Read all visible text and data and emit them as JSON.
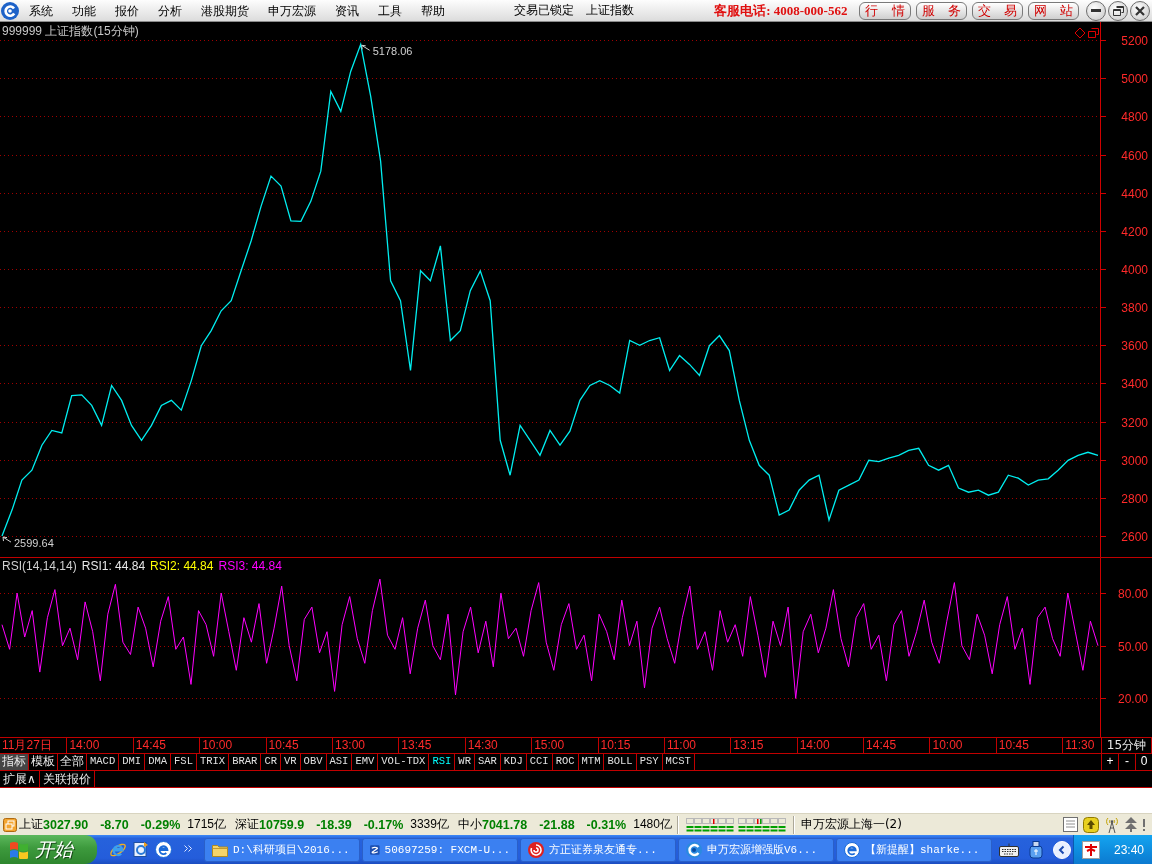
{
  "menu_bar": {
    "items": [
      "系统",
      "功能",
      "报价",
      "分析",
      "港股期货",
      "申万宏源",
      "资讯",
      "工具",
      "帮助"
    ],
    "lock_status": "交易已锁定",
    "current_index": "上证指数",
    "hotline": "客服电话: 4008-000-562",
    "quick_buttons": [
      "行 情",
      "服 务",
      "交 易",
      "网 站"
    ]
  },
  "price_chart": {
    "chart_data": {
      "type": "line",
      "title": "999999 上证指数(15分钟)",
      "grid": true,
      "ylim": [
        2490,
        5295
      ],
      "yticks": [
        2600,
        2800,
        3000,
        3200,
        3400,
        3600,
        3800,
        4000,
        4200,
        4400,
        4600,
        4800,
        5000,
        5200
      ],
      "values": [
        2599.64,
        2736,
        2893,
        2945,
        3076,
        3154,
        3140,
        3337,
        3340,
        3285,
        3180,
        3389,
        3311,
        3180,
        3102,
        3180,
        3285,
        3311,
        3260,
        3415,
        3598,
        3677,
        3781,
        3834,
        3991,
        4147,
        4330,
        4487,
        4435,
        4252,
        4250,
        4356,
        4513,
        4931,
        4827,
        5036,
        5178.06,
        4905,
        4565,
        3938,
        3834,
        3468,
        3991,
        3938,
        4121,
        3625,
        3677,
        3886,
        3990,
        3834,
        3102,
        2919,
        3180,
        3102,
        3023,
        3154,
        3076,
        3150,
        3311,
        3389,
        3415,
        3389,
        3350,
        3625,
        3600,
        3625,
        3640,
        3468,
        3546,
        3500,
        3442,
        3598,
        3651,
        3572,
        3311,
        3102,
        2971,
        2919,
        2710,
        2736,
        2840,
        2893,
        2919,
        2684,
        2840,
        2867,
        2893,
        2997,
        2990,
        3008,
        3023,
        3049,
        3060,
        2971,
        2945,
        2971,
        2851,
        2830,
        2840,
        2814,
        2830,
        2919,
        2903,
        2867,
        2893,
        2900,
        2945,
        2997,
        3023,
        3039,
        3023
      ],
      "annotations": [
        "5178.06",
        "2599.64"
      ]
    }
  },
  "rsi_chart": {
    "legend": [
      {
        "label": "RSI1: 44.84",
        "color": "#e8e8e8"
      },
      {
        "label": "RSI2: 44.84",
        "color": "#ffff00"
      },
      {
        "label": "RSI3: 44.84",
        "color": "#ff00ff"
      }
    ],
    "chart_data": {
      "type": "line",
      "title": "RSI(14,14,14)",
      "grid": true,
      "ylim": [
        -2,
        100
      ],
      "yticks": [
        {
          "value": 20,
          "label": "20.00"
        },
        {
          "value": 50,
          "label": "50.00"
        },
        {
          "value": 80,
          "label": "80.00"
        }
      ],
      "series": [
        {
          "color": "#ff00ff",
          "values": [
            62,
            48,
            80,
            55,
            70,
            35,
            66,
            82,
            50,
            60,
            42,
            75,
            58,
            30,
            68,
            85,
            52,
            45,
            72,
            60,
            38,
            64,
            78,
            48,
            55,
            28,
            70,
            62,
            44,
            80,
            58,
            36,
            66,
            52,
            74,
            40,
            60,
            84,
            50,
            30,
            65,
            72,
            46,
            58,
            24,
            62,
            78,
            54,
            40,
            70,
            88,
            56,
            48,
            66,
            34,
            60,
            76,
            50,
            42,
            68,
            22,
            58,
            72,
            46,
            64,
            38,
            80,
            54,
            60,
            44,
            70,
            86,
            52,
            36,
            62,
            74,
            48,
            56,
            30,
            68,
            58,
            42,
            76,
            50,
            64,
            26,
            60,
            72,
            54,
            40,
            66,
            84,
            48,
            58,
            36,
            70,
            52,
            62,
            44,
            78,
            56,
            32,
            64,
            50,
            72,
            20,
            58,
            68,
            46,
            60,
            82,
            54,
            38,
            66,
            74,
            48,
            56,
            30,
            62,
            70,
            44,
            58,
            76,
            52,
            40,
            64,
            86,
            50,
            42,
            68,
            56,
            34,
            62,
            78,
            48,
            60,
            28,
            66,
            72,
            54,
            44,
            80,
            58,
            36,
            64,
            50
          ]
        }
      ]
    }
  },
  "time_axis": {
    "labels": [
      "11月27日",
      "14:00",
      "14:45",
      "10:00",
      "10:45",
      "13:00",
      "13:45",
      "14:30",
      "15:00",
      "10:15",
      "11:00",
      "13:15",
      "14:00",
      "14:45",
      "10:00",
      "10:45",
      "11:30"
    ],
    "period": "15分钟"
  },
  "indicator_bar": {
    "modes": [
      {
        "label": "指标",
        "selected": true
      },
      {
        "label": "模板",
        "selected": false
      },
      {
        "label": "全部",
        "selected": false
      }
    ],
    "indicators": [
      {
        "label": "MACD",
        "selected": false
      },
      {
        "label": "DMI",
        "selected": false
      },
      {
        "label": "DMA",
        "selected": false
      },
      {
        "label": "FSL",
        "selected": false
      },
      {
        "label": "TRIX",
        "selected": false
      },
      {
        "label": "BRAR",
        "selected": false
      },
      {
        "label": "CR",
        "selected": false
      },
      {
        "label": "VR",
        "selected": false
      },
      {
        "label": "OBV",
        "selected": false
      },
      {
        "label": "ASI",
        "selected": false
      },
      {
        "label": "EMV",
        "selected": false
      },
      {
        "label": "VOL-TDX",
        "selected": false
      },
      {
        "label": "RSI",
        "selected": true
      },
      {
        "label": "WR",
        "selected": false
      },
      {
        "label": "SAR",
        "selected": false
      },
      {
        "label": "KDJ",
        "selected": false
      },
      {
        "label": "CCI",
        "selected": false
      },
      {
        "label": "ROC",
        "selected": false
      },
      {
        "label": "MTM",
        "selected": false
      },
      {
        "label": "BOLL",
        "selected": false
      },
      {
        "label": "PSY",
        "selected": false
      },
      {
        "label": "MCST",
        "selected": false
      }
    ],
    "zoom_buttons": [
      "+",
      "-",
      "0"
    ]
  },
  "extension_bar": {
    "tabs": [
      "扩展∧",
      "关联报价"
    ]
  },
  "status_bar": {
    "indices": [
      {
        "name": "上证",
        "price": "3027.90",
        "change": "-8.70",
        "percent": "-0.29%",
        "turnover": "1715亿"
      },
      {
        "name": "深证",
        "price": "10759.9",
        "change": "-18.39",
        "percent": "-0.17%",
        "turnover": "3339亿"
      },
      {
        "name": "中小",
        "price": "7041.78",
        "change": "-21.88",
        "percent": "-0.31%",
        "turnover": "1480亿"
      }
    ],
    "server": "申万宏源上海一(2)"
  },
  "taskbar": {
    "start_label": "开始",
    "tasks": [
      {
        "label": "D:\\科研项目\\2016...",
        "kind": "folder",
        "selected": false
      },
      {
        "label": "50697259: FXCM-U...",
        "kind": "terminal",
        "selected": false
      },
      {
        "label": "方正证券泉友通专...",
        "kind": "redswirl",
        "selected": false
      },
      {
        "label": "申万宏源增强版V6...",
        "kind": "blueswirl",
        "selected": false
      },
      {
        "label": "【新提醒】sharke...",
        "kind": "browser",
        "selected": false
      }
    ],
    "clock": "23:40"
  }
}
